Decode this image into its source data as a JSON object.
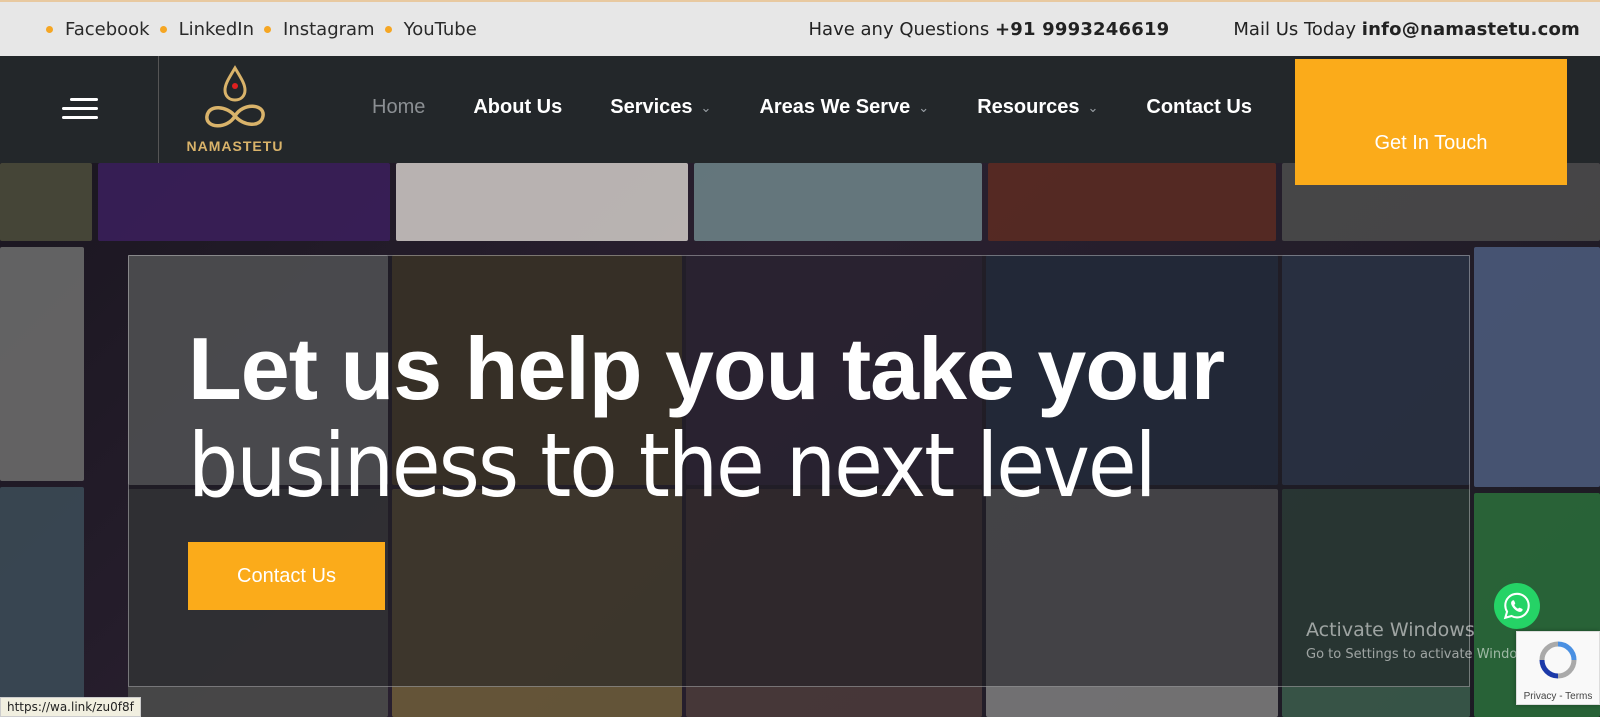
{
  "topbar": {
    "social": [
      "Facebook",
      "LinkedIn",
      "Instagram",
      "YouTube"
    ],
    "phone_label": "Have any Questions",
    "phone": "+91 9993246619",
    "mail_label": "Mail Us Today",
    "email": "info@namastetu.com"
  },
  "nav": {
    "logo_text": "NAMASTETU",
    "items": [
      {
        "label": "Home",
        "active": true
      },
      {
        "label": "About Us"
      },
      {
        "label": "Services",
        "dropdown": true
      },
      {
        "label": "Areas We Serve",
        "dropdown": true
      },
      {
        "label": "Resources",
        "dropdown": true
      },
      {
        "label": "Contact Us"
      }
    ],
    "cta": "Get In Touch"
  },
  "hero": {
    "line1": "Let us help you take your",
    "line2": "business to the next level",
    "cta": "Contact Us"
  },
  "overlay": {
    "activate_title": "Activate Windows",
    "activate_sub": "Go to Settings to activate Windows.",
    "recaptcha_terms": "Privacy - Terms",
    "status_url": "https://wa.link/zu0f8f"
  },
  "colors": {
    "accent": "#fbab1a",
    "nav_bg": "#23272a",
    "topbar_bg": "#e7e7e7",
    "whatsapp": "#25d366"
  }
}
